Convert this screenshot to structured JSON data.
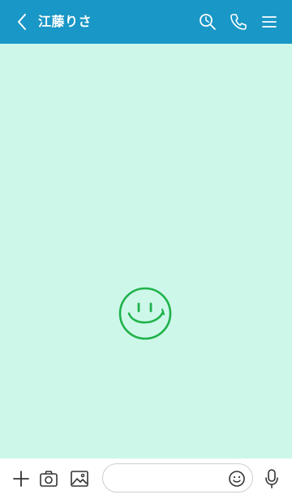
{
  "header": {
    "title": "江藤りさ",
    "back_icon": "chevron-left-icon",
    "search_icon": "search-clock-icon",
    "call_icon": "phone-icon",
    "menu_icon": "hamburger-menu-icon"
  },
  "chat": {
    "background_icon": "smiley-icon"
  },
  "bottom_bar": {
    "add_icon": "plus-icon",
    "camera_icon": "camera-icon",
    "image_icon": "image-icon",
    "message_input": {
      "value": "",
      "placeholder": ""
    },
    "emoji_icon": "emoji-icon",
    "mic_icon": "microphone-icon"
  },
  "colors": {
    "header_bg": "#1997c6",
    "chat_bg": "#cdf7e9",
    "smiley": "#1fb24a",
    "icon_dark": "#333333"
  }
}
